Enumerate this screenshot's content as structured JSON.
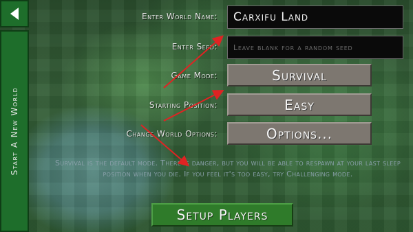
{
  "sidebar": {
    "back_icon": "triangle-left-icon",
    "tab_label": "Start A New World"
  },
  "form": {
    "world_name_label": "Enter World Name:",
    "world_name_value": "Carxifu Land",
    "seed_label": "Enter Seed:",
    "seed_placeholder": "Leave blank for a random seed",
    "game_mode_label": "Game Mode:",
    "game_mode_value": "Survival",
    "start_position_label": "Starting Position:",
    "start_position_value": "Easy",
    "world_options_label": "Change World Options:",
    "world_options_value": "Options..."
  },
  "description": "Survival is the default mode. There is danger, but you will be able to respawn at your last sleep position when you die. If you feel it's too easy, try Challenging mode.",
  "footer": {
    "setup_players": "Setup Players"
  },
  "colors": {
    "nav_green": "#1e6e2b",
    "button_gray": "#7d7770",
    "setup_green": "#2f7b2a",
    "annotation_arrow": "#e02323"
  }
}
